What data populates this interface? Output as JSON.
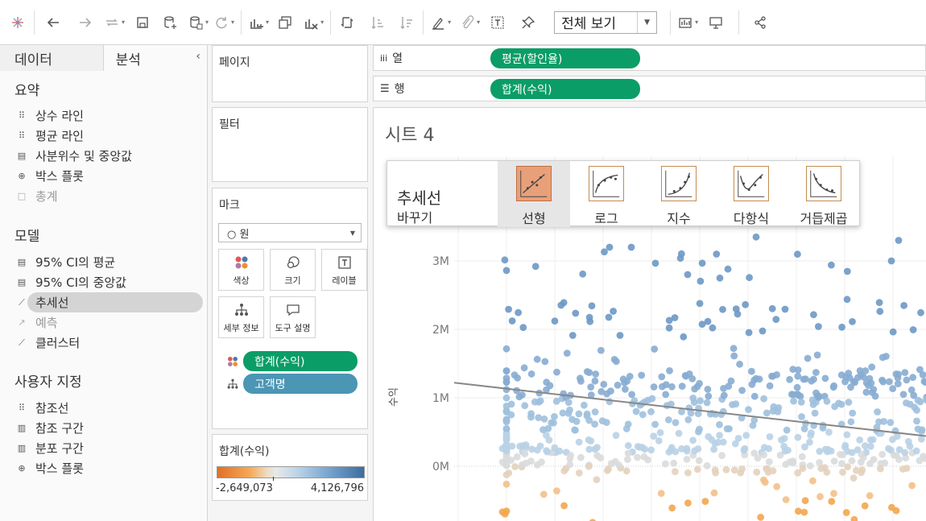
{
  "toolbar": {
    "view_select": "전체 보기"
  },
  "left": {
    "tabs": [
      "데이터",
      "분석"
    ],
    "sections": [
      {
        "title": "요약",
        "items": [
          {
            "label": "상수 라인",
            "icon": "constant-line-icon",
            "disabled": false
          },
          {
            "label": "평균 라인",
            "icon": "average-line-icon",
            "disabled": false
          },
          {
            "label": "사분위수 및 중앙값",
            "icon": "quartile-icon",
            "disabled": false
          },
          {
            "label": "박스 플롯",
            "icon": "box-plot-icon",
            "disabled": false
          },
          {
            "label": "총계",
            "icon": "totals-icon",
            "disabled": true
          }
        ]
      },
      {
        "title": "모델",
        "items": [
          {
            "label": "95% CI의 평균",
            "icon": "ci-mean-icon",
            "disabled": false
          },
          {
            "label": "95% CI의 중앙값",
            "icon": "ci-median-icon",
            "disabled": false
          },
          {
            "label": "추세선",
            "icon": "trend-line-icon",
            "disabled": false,
            "selected": true
          },
          {
            "label": "예측",
            "icon": "forecast-icon",
            "disabled": true
          },
          {
            "label": "클러스터",
            "icon": "cluster-icon",
            "disabled": false
          }
        ]
      },
      {
        "title": "사용자 지정",
        "items": [
          {
            "label": "참조선",
            "icon": "reference-line-icon",
            "disabled": false
          },
          {
            "label": "참조 구간",
            "icon": "reference-band-icon",
            "disabled": false
          },
          {
            "label": "분포 구간",
            "icon": "distribution-band-icon",
            "disabled": false
          },
          {
            "label": "박스 플롯",
            "icon": "box-plot-icon",
            "disabled": false
          }
        ]
      }
    ]
  },
  "cards": {
    "pages": "페이지",
    "filters": "필터",
    "marks": "마크",
    "mark_type": "원",
    "mark_buttons": [
      "색상",
      "크기",
      "레이블",
      "세부 정보",
      "도구 설명"
    ],
    "mark_pills": [
      "합계(수익)",
      "고객명"
    ],
    "legend_title": "합계(수익)",
    "legend_min": "-2,649,073",
    "legend_max": "4,126,796"
  },
  "shelves": {
    "columns_label": "열",
    "columns_pill": "평균(할인율)",
    "rows_label": "행",
    "rows_pill": "합계(수익)"
  },
  "sheet_title": "시트 4",
  "trend_popup": {
    "title": "추세선",
    "subtitle": "바꾸기",
    "options": [
      "선형",
      "로그",
      "지수",
      "다항식",
      "거듭제곱"
    ],
    "selected": 0
  },
  "colors": {
    "green_pill": "#0b9d67",
    "blue_pill": "#4b95b5",
    "legend_low": "#e07028",
    "legend_high": "#3b6e9e"
  },
  "chart_data": {
    "type": "scatter",
    "ylabel": "수익",
    "ytick_labels": [
      "0M",
      "1M",
      "2M",
      "3M"
    ],
    "y_ticks": [
      0,
      1000000,
      2000000,
      3000000
    ],
    "trend": {
      "type": "linear"
    }
  }
}
